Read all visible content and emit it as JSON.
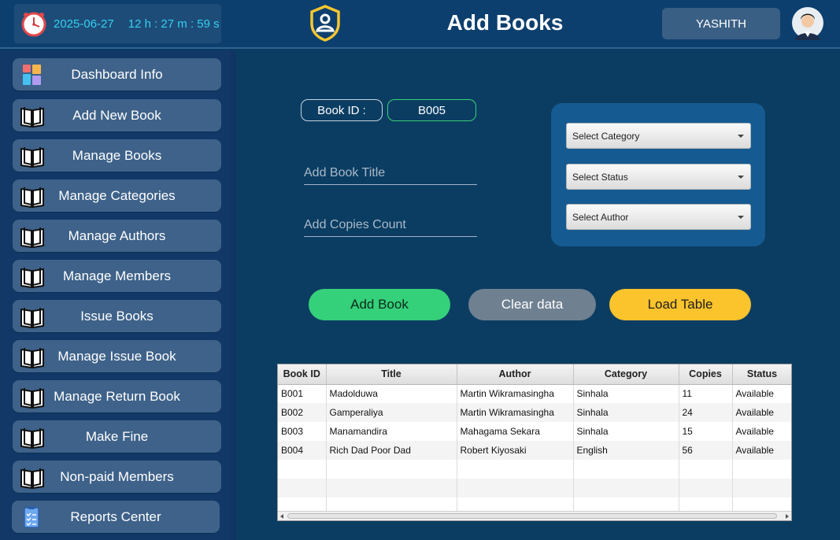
{
  "header": {
    "date": "2025-06-27",
    "time": "12 h : 27 m : 59 s",
    "title": "Add Books",
    "username": "YASHITH"
  },
  "sidebar": {
    "items": [
      {
        "label": "Dashboard Info",
        "icon": "dashboard-icon"
      },
      {
        "label": "Add New Book",
        "icon": "book-icon"
      },
      {
        "label": "Manage Books",
        "icon": "book-icon"
      },
      {
        "label": "Manage Categories",
        "icon": "book-icon"
      },
      {
        "label": "Manage Authors",
        "icon": "book-icon"
      },
      {
        "label": "Manage Members",
        "icon": "book-icon"
      },
      {
        "label": "Issue Books",
        "icon": "book-icon"
      },
      {
        "label": "Manage Issue Book",
        "icon": "book-icon"
      },
      {
        "label": "Manage Return Book",
        "icon": "book-icon"
      },
      {
        "label": "Make Fine",
        "icon": "book-icon"
      },
      {
        "label": "Non-paid Members",
        "icon": "book-icon"
      },
      {
        "label": "Reports Center",
        "icon": "report-clipboard-icon"
      }
    ]
  },
  "form": {
    "book_id_label": "Book ID :",
    "book_id_value": "B005",
    "title_placeholder": "Add Book Title",
    "copies_placeholder": "Add Copies Count",
    "category_select": "Select Category",
    "status_select": "Select Status",
    "author_select": "Select Author"
  },
  "actions": {
    "add": "Add Book",
    "clear": "Clear data",
    "load": "Load Table"
  },
  "table": {
    "columns": [
      "Book ID",
      "Title",
      "Author",
      "Category",
      "Copies",
      "Status"
    ],
    "rows": [
      [
        "B001",
        "Madolduwa",
        "Martin Wikramasingha",
        "Sinhala",
        "11",
        "Available"
      ],
      [
        "B002",
        "Gamperaliya",
        "Martin Wikramasingha",
        "Sinhala",
        "24",
        "Available"
      ],
      [
        "B003",
        "Manamandira",
        "Mahagama Sekara",
        "Sinhala",
        "15",
        "Available"
      ],
      [
        "B004",
        "Rich Dad Poor Dad",
        "Robert Kiyosaki",
        "English",
        "56",
        "Available"
      ]
    ]
  },
  "colors": {
    "background": "#0b3a63",
    "add_button": "#35d07a",
    "clear_button": "#6f8091",
    "load_button": "#fbc32c",
    "accent_text": "#33d0f0"
  }
}
